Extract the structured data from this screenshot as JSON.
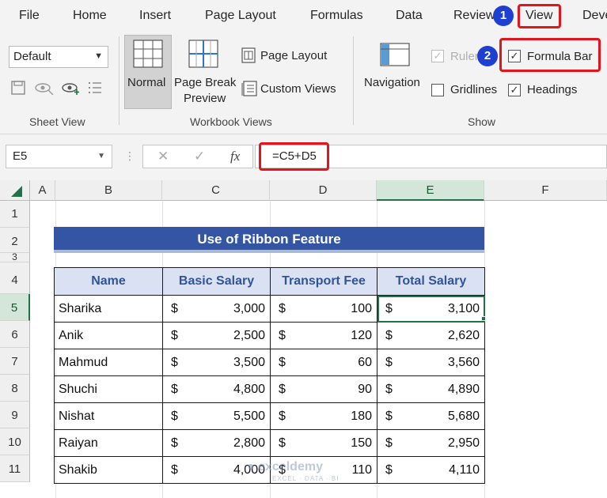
{
  "menu": {
    "items": [
      "File",
      "Home",
      "Insert",
      "Page Layout",
      "Formulas",
      "Data",
      "Review",
      "View",
      "Deve"
    ],
    "step_badges": [
      "1",
      "2"
    ]
  },
  "ribbon": {
    "sheet_view": {
      "dropdown_value": "Default",
      "group_label": "Sheet View"
    },
    "workbook_views": {
      "normal": "Normal",
      "page_break_line1": "Page Break",
      "page_break_line2": "Preview",
      "page_layout": "Page Layout",
      "custom_views": "Custom Views",
      "group_label": "Workbook Views"
    },
    "show": {
      "navigation": "Navigation",
      "ruler": "Ruler",
      "gridlines": "Gridlines",
      "formula_bar": "Formula Bar",
      "headings": "Headings",
      "group_label": "Show",
      "ruler_checked": true,
      "formula_bar_checked": true,
      "gridlines_checked": false,
      "headings_checked": true
    }
  },
  "formula_bar": {
    "name_box": "E5",
    "formula": "=C5+D5"
  },
  "sheet": {
    "columns": [
      "A",
      "B",
      "C",
      "D",
      "E",
      "F"
    ],
    "rows": [
      "1",
      "2",
      "3",
      "4",
      "5",
      "6",
      "7",
      "8",
      "9",
      "10",
      "11"
    ],
    "selected_column": "E",
    "selected_row": "5",
    "title": "Use of Ribbon Feature",
    "headers": [
      "Name",
      "Basic Salary",
      "Transport Fee",
      "Total Salary"
    ],
    "currency": "$",
    "data": [
      {
        "name": "Sharika",
        "basic": "3,000",
        "transport": "100",
        "total": "3,100"
      },
      {
        "name": "Anik",
        "basic": "2,500",
        "transport": "120",
        "total": "2,620"
      },
      {
        "name": "Mahmud",
        "basic": "3,500",
        "transport": "60",
        "total": "3,560"
      },
      {
        "name": "Shuchi",
        "basic": "4,800",
        "transport": "90",
        "total": "4,890"
      },
      {
        "name": "Nishat",
        "basic": "5,500",
        "transport": "180",
        "total": "5,680"
      },
      {
        "name": "Raiyan",
        "basic": "2,800",
        "transport": "150",
        "total": "2,950"
      },
      {
        "name": "Shakib",
        "basic": "4,000",
        "transport": "110",
        "total": "4,110"
      }
    ]
  },
  "watermark": {
    "brand": "exceldemy",
    "tagline": "EXCEL · DATA · BI"
  },
  "colors": {
    "highlight": "#e3141b",
    "badge": "#1f3fd1",
    "title_band": "#3355a3",
    "header_fill": "#d9e1f2",
    "header_text": "#2f5597",
    "excel_green": "#217346"
  }
}
